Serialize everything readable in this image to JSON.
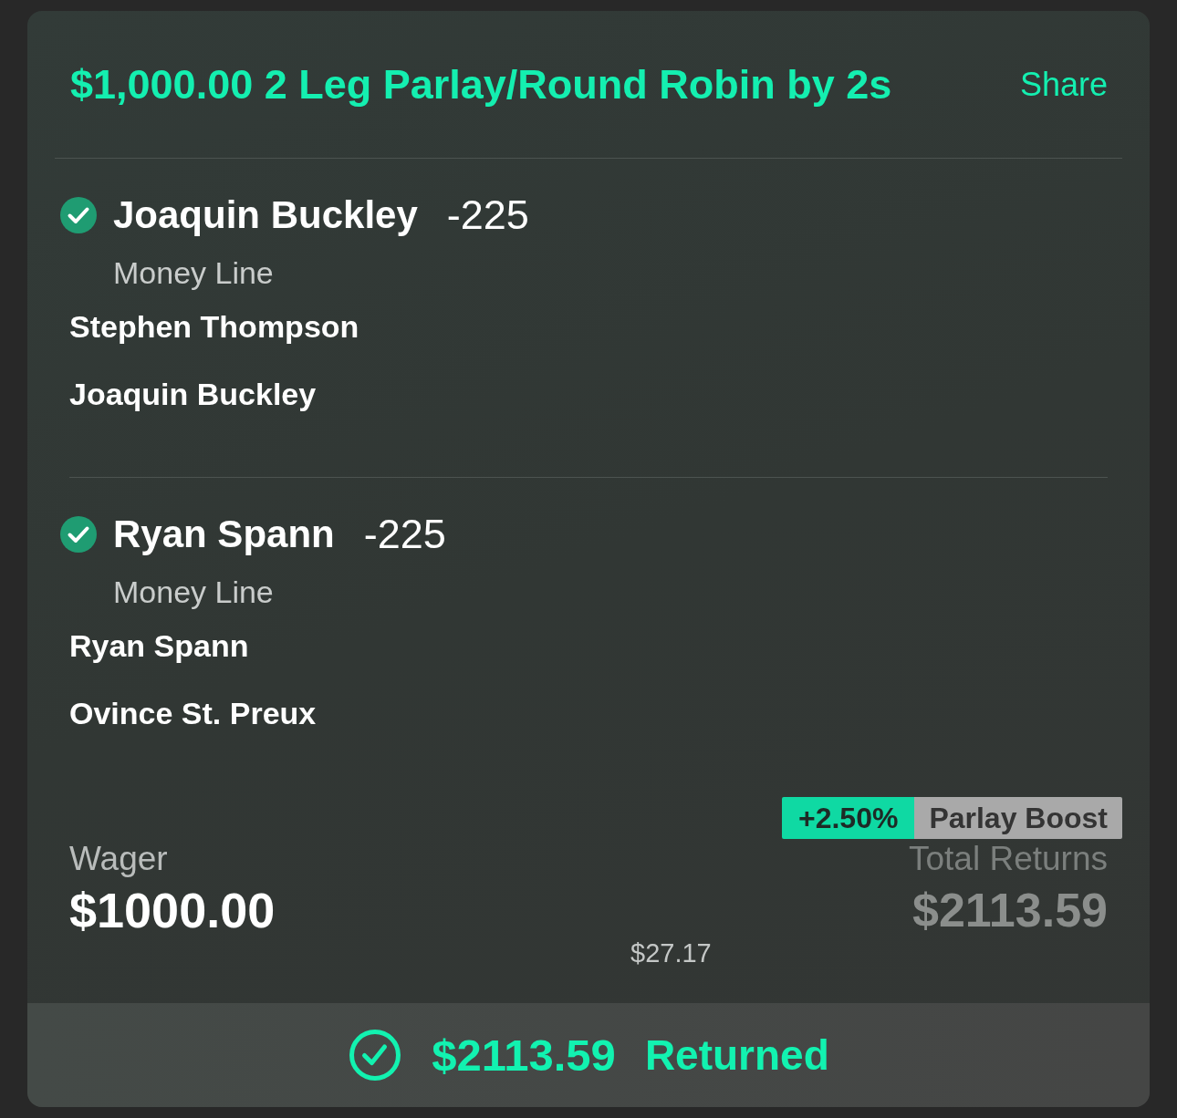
{
  "bet": {
    "title": "$1,000.00 2 Leg Parlay/Round Robin by 2s",
    "share": "Share"
  },
  "legs": [
    {
      "won": true,
      "selection": "Joaquin Buckley",
      "odds": "-225",
      "market": "Money Line",
      "competitors": [
        "Stephen Thompson",
        "Joaquin Buckley"
      ]
    },
    {
      "won": true,
      "selection": "Ryan Spann",
      "odds": "-225",
      "market": "Money Line",
      "competitors": [
        "Ryan Spann",
        "Ovince St. Preux"
      ]
    }
  ],
  "boost": {
    "percent": "+2.50%",
    "label": "Parlay Boost",
    "amount": "$27.17"
  },
  "wager": {
    "label": "Wager",
    "amount": "$1000.00"
  },
  "returns": {
    "label": "Total Returns",
    "amount": "$2113.59"
  },
  "result": {
    "amount": "$2113.59",
    "label": "Returned"
  }
}
